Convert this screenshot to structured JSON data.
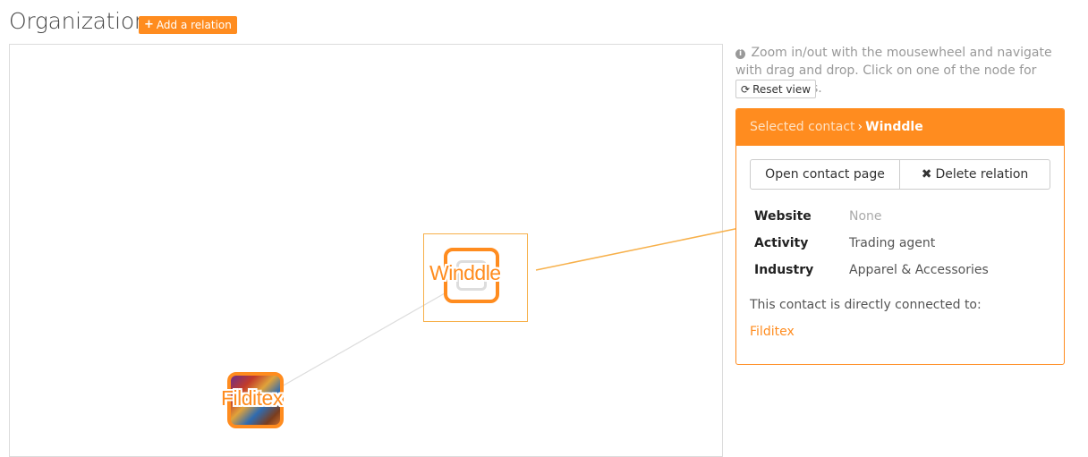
{
  "header": {
    "title": "Organization",
    "add_relation_label": "Add a relation"
  },
  "graph": {
    "nodes": [
      {
        "label": "Winddle",
        "selected": true
      },
      {
        "label": "Filditex",
        "selected": false
      }
    ]
  },
  "sidebar": {
    "hint": "Zoom in/out with the mousewheel and navigate with drag and drop. Click on one of the node for more options.",
    "reset_label": "Reset view"
  },
  "panel": {
    "crumb": "Selected contact",
    "selected_name": "Winddle",
    "open_label": "Open contact page",
    "delete_label": "Delete relation",
    "fields": [
      {
        "key": "Website",
        "value": "None"
      },
      {
        "key": "Activity",
        "value": "Trading agent"
      },
      {
        "key": "Industry",
        "value": "Apparel & Accessories"
      }
    ],
    "connected_text": "This contact is directly connected to:",
    "connections": [
      "Filditex"
    ]
  },
  "colors": {
    "accent": "#ff8c1f",
    "arrow": "#f7b04a"
  }
}
